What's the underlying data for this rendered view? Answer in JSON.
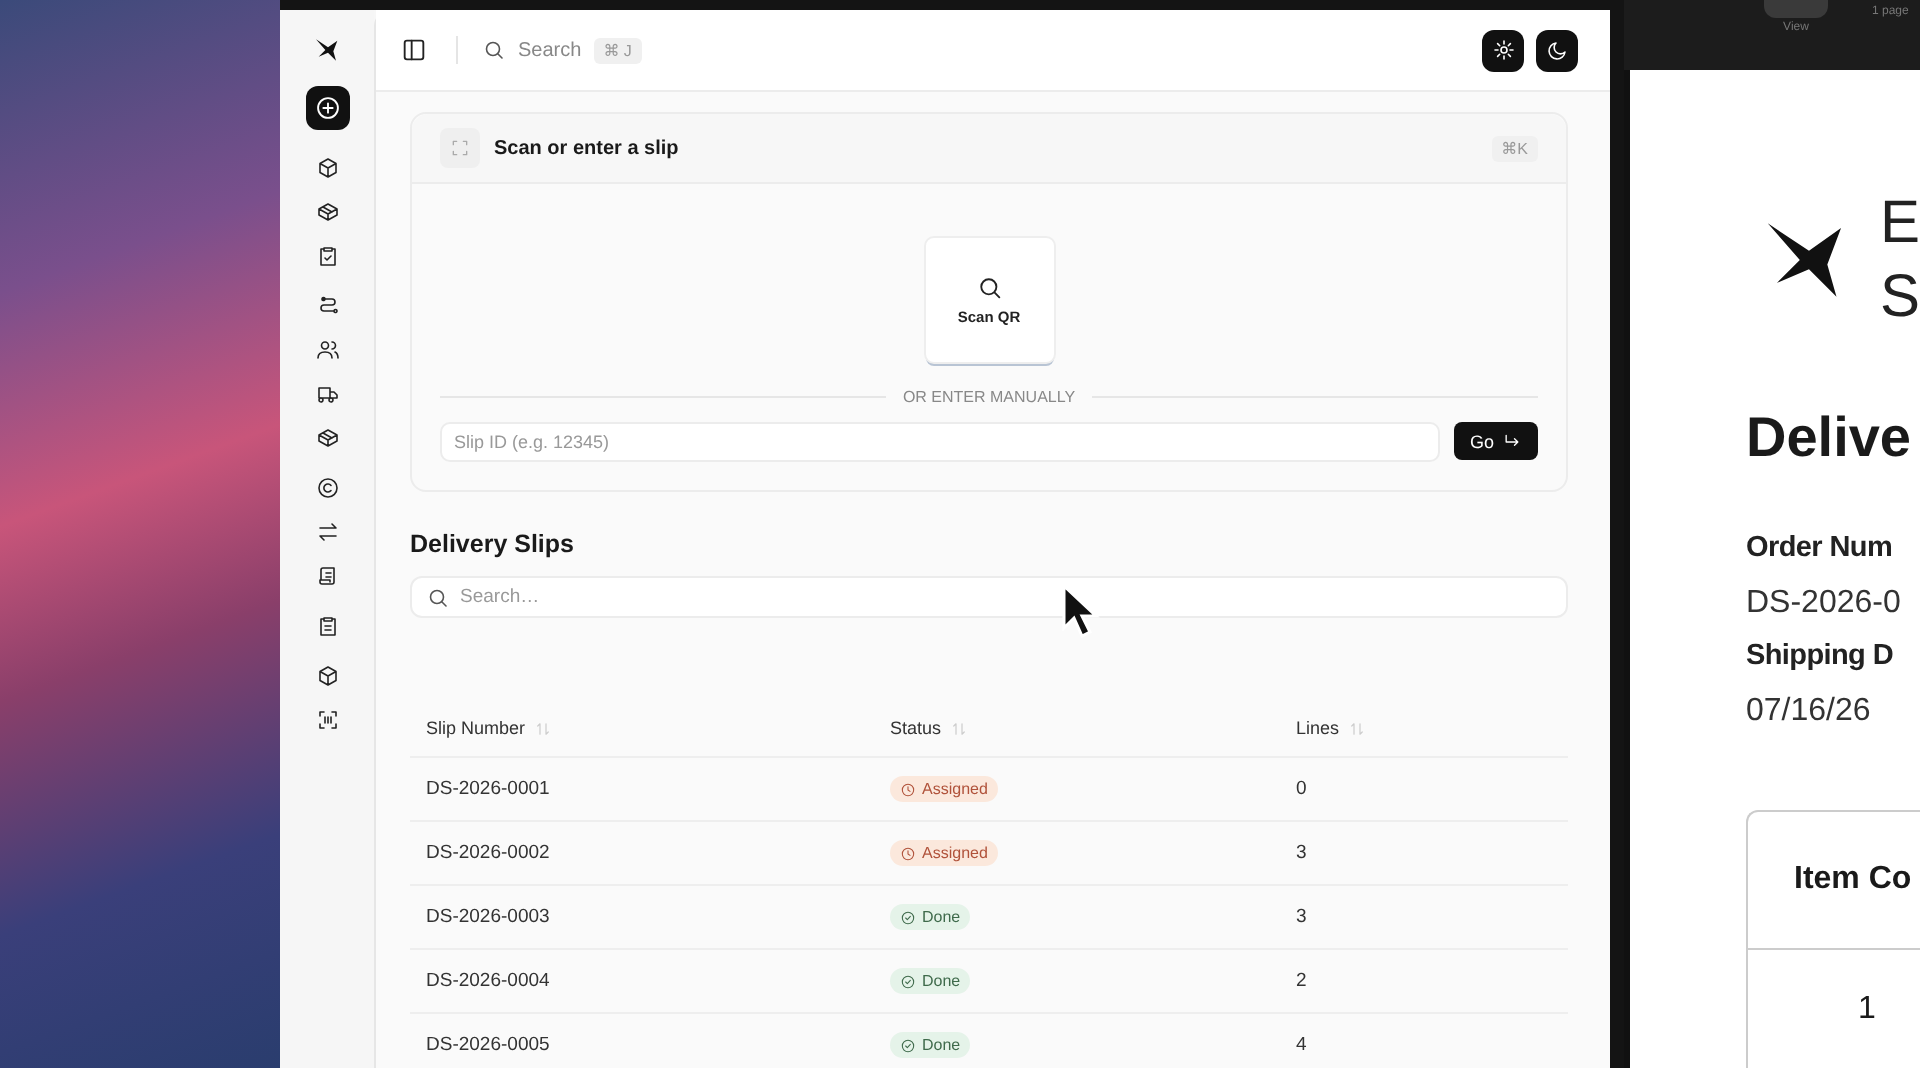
{
  "header": {
    "search": {
      "placeholder": "Search",
      "shortcut": "⌘ J"
    }
  },
  "scan_card": {
    "title": "Scan or enter a slip",
    "shortcut": "⌘K",
    "scan_button": "Scan QR",
    "divider": "OR ENTER MANUALLY",
    "slip_field": {
      "placeholder": "Slip ID (e.g. 12345)"
    },
    "go_button": "Go"
  },
  "slips": {
    "title": "Delivery Slips",
    "search": {
      "placeholder": "Search…"
    },
    "table": {
      "columns": [
        "Slip Number",
        "Status",
        "Lines"
      ],
      "rows": [
        {
          "slip_number": "DS-2026-0001",
          "status": {
            "label": "Assigned",
            "kind": "assigned"
          },
          "lines": "0"
        },
        {
          "slip_number": "DS-2026-0002",
          "status": {
            "label": "Assigned",
            "kind": "assigned"
          },
          "lines": "3"
        },
        {
          "slip_number": "DS-2026-0003",
          "status": {
            "label": "Done",
            "kind": "done"
          },
          "lines": "3"
        },
        {
          "slip_number": "DS-2026-0004",
          "status": {
            "label": "Done",
            "kind": "done"
          },
          "lines": "2"
        },
        {
          "slip_number": "DS-2026-0005",
          "status": {
            "label": "Done",
            "kind": "done"
          },
          "lines": "4"
        }
      ]
    }
  },
  "document_viewer": {
    "toolbar": {
      "view_label": "View",
      "page_count": "1 page"
    },
    "page": {
      "logo_lines": [
        "E",
        "S"
      ],
      "title": "Delive",
      "fields": [
        {
          "label": "Order Num",
          "value": "DS-2026-0"
        },
        {
          "label": "Shipping D",
          "value": "07/16/26"
        }
      ],
      "table": {
        "columns": [
          "Item Co"
        ],
        "rows": [
          [
            "1"
          ]
        ]
      }
    }
  }
}
